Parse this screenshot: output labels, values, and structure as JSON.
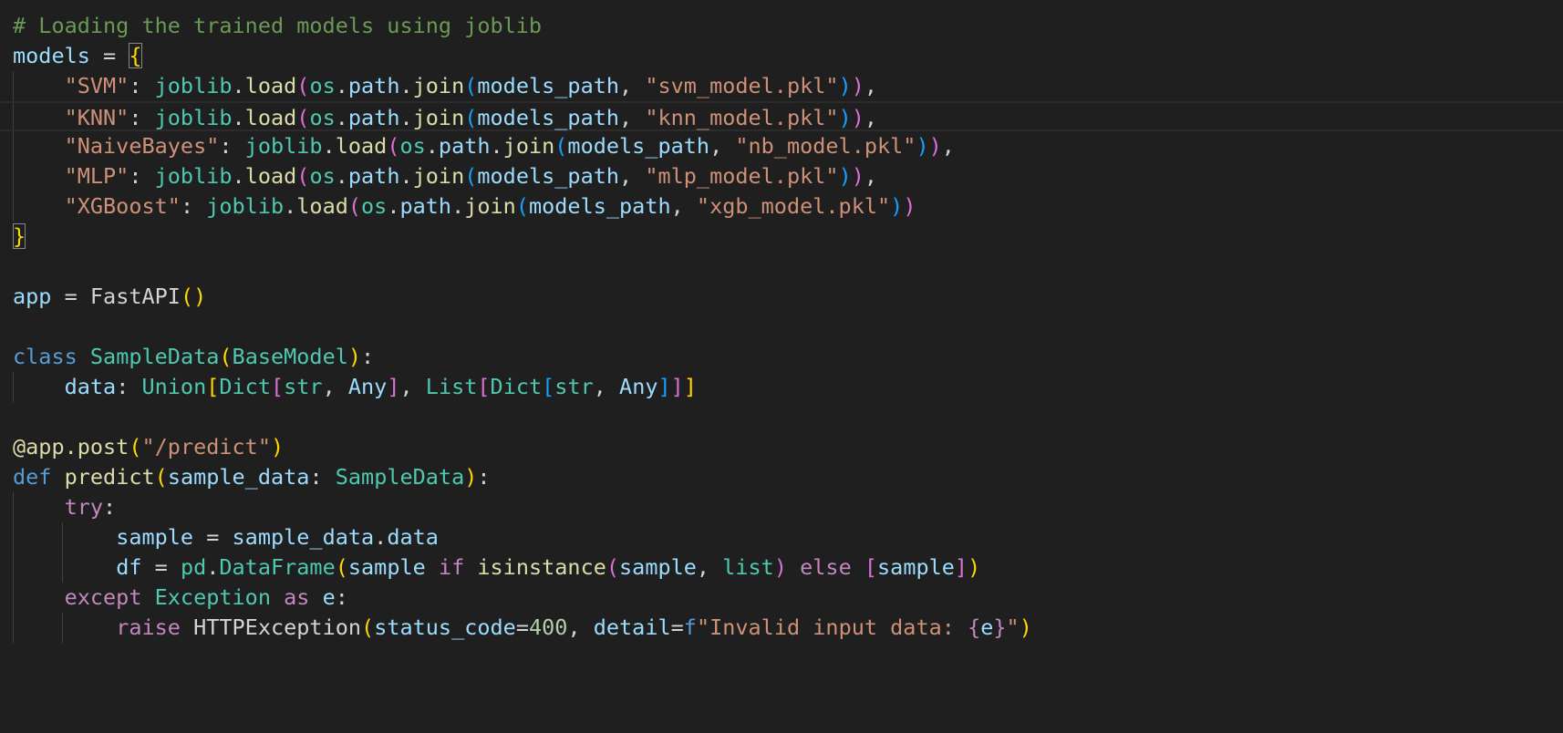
{
  "lines": [
    [
      {
        "t": "# Loading the trained models using joblib",
        "c": "comment"
      }
    ],
    [
      {
        "t": "models",
        "c": "var"
      },
      {
        "t": " = ",
        "c": "op"
      },
      {
        "t": "{",
        "c": "b1",
        "m": true
      }
    ],
    [
      {
        "t": "    ",
        "c": "op"
      },
      {
        "t": "\"SVM\"",
        "c": "str"
      },
      {
        "t": ": ",
        "c": "op"
      },
      {
        "t": "joblib",
        "c": "class"
      },
      {
        "t": ".",
        "c": "op"
      },
      {
        "t": "load",
        "c": "func"
      },
      {
        "t": "(",
        "c": "b2"
      },
      {
        "t": "os",
        "c": "class"
      },
      {
        "t": ".",
        "c": "op"
      },
      {
        "t": "path",
        "c": "var"
      },
      {
        "t": ".",
        "c": "op"
      },
      {
        "t": "join",
        "c": "func"
      },
      {
        "t": "(",
        "c": "b3"
      },
      {
        "t": "models_path",
        "c": "var"
      },
      {
        "t": ", ",
        "c": "op"
      },
      {
        "t": "\"svm_model.pkl\"",
        "c": "str"
      },
      {
        "t": ")",
        "c": "b3"
      },
      {
        "t": ")",
        "c": "b2"
      },
      {
        "t": ",",
        "c": "op"
      }
    ],
    [
      {
        "t": "    ",
        "c": "op"
      },
      {
        "t": "\"KNN\"",
        "c": "str"
      },
      {
        "t": ": ",
        "c": "op"
      },
      {
        "t": "joblib",
        "c": "class"
      },
      {
        "t": ".",
        "c": "op"
      },
      {
        "t": "load",
        "c": "func"
      },
      {
        "t": "(",
        "c": "b2"
      },
      {
        "t": "os",
        "c": "class"
      },
      {
        "t": ".",
        "c": "op"
      },
      {
        "t": "path",
        "c": "var"
      },
      {
        "t": ".",
        "c": "op"
      },
      {
        "t": "join",
        "c": "func"
      },
      {
        "t": "(",
        "c": "b3"
      },
      {
        "t": "models_path",
        "c": "var"
      },
      {
        "t": ", ",
        "c": "op"
      },
      {
        "t": "\"knn_model.pkl\"",
        "c": "str"
      },
      {
        "t": ")",
        "c": "b3"
      },
      {
        "t": ")",
        "c": "b2"
      },
      {
        "t": ",",
        "c": "op"
      }
    ],
    [
      {
        "t": "    ",
        "c": "op"
      },
      {
        "t": "\"NaiveBayes\"",
        "c": "str"
      },
      {
        "t": ": ",
        "c": "op"
      },
      {
        "t": "joblib",
        "c": "class"
      },
      {
        "t": ".",
        "c": "op"
      },
      {
        "t": "load",
        "c": "func"
      },
      {
        "t": "(",
        "c": "b2"
      },
      {
        "t": "os",
        "c": "class"
      },
      {
        "t": ".",
        "c": "op"
      },
      {
        "t": "path",
        "c": "var"
      },
      {
        "t": ".",
        "c": "op"
      },
      {
        "t": "join",
        "c": "func"
      },
      {
        "t": "(",
        "c": "b3"
      },
      {
        "t": "models_path",
        "c": "var"
      },
      {
        "t": ", ",
        "c": "op"
      },
      {
        "t": "\"nb_model.pkl\"",
        "c": "str"
      },
      {
        "t": ")",
        "c": "b3"
      },
      {
        "t": ")",
        "c": "b2"
      },
      {
        "t": ",",
        "c": "op"
      }
    ],
    [
      {
        "t": "    ",
        "c": "op"
      },
      {
        "t": "\"MLP\"",
        "c": "str"
      },
      {
        "t": ": ",
        "c": "op"
      },
      {
        "t": "joblib",
        "c": "class"
      },
      {
        "t": ".",
        "c": "op"
      },
      {
        "t": "load",
        "c": "func"
      },
      {
        "t": "(",
        "c": "b2"
      },
      {
        "t": "os",
        "c": "class"
      },
      {
        "t": ".",
        "c": "op"
      },
      {
        "t": "path",
        "c": "var"
      },
      {
        "t": ".",
        "c": "op"
      },
      {
        "t": "join",
        "c": "func"
      },
      {
        "t": "(",
        "c": "b3"
      },
      {
        "t": "models_path",
        "c": "var"
      },
      {
        "t": ", ",
        "c": "op"
      },
      {
        "t": "\"mlp_model.pkl\"",
        "c": "str"
      },
      {
        "t": ")",
        "c": "b3"
      },
      {
        "t": ")",
        "c": "b2"
      },
      {
        "t": ",",
        "c": "op"
      }
    ],
    [
      {
        "t": "    ",
        "c": "op"
      },
      {
        "t": "\"XGBoost\"",
        "c": "str"
      },
      {
        "t": ": ",
        "c": "op"
      },
      {
        "t": "joblib",
        "c": "class"
      },
      {
        "t": ".",
        "c": "op"
      },
      {
        "t": "load",
        "c": "func"
      },
      {
        "t": "(",
        "c": "b2"
      },
      {
        "t": "os",
        "c": "class"
      },
      {
        "t": ".",
        "c": "op"
      },
      {
        "t": "path",
        "c": "var"
      },
      {
        "t": ".",
        "c": "op"
      },
      {
        "t": "join",
        "c": "func"
      },
      {
        "t": "(",
        "c": "b3"
      },
      {
        "t": "models_path",
        "c": "var"
      },
      {
        "t": ", ",
        "c": "op"
      },
      {
        "t": "\"xgb_model.pkl\"",
        "c": "str"
      },
      {
        "t": ")",
        "c": "b3"
      },
      {
        "t": ")",
        "c": "b2"
      }
    ],
    [
      {
        "t": "}",
        "c": "b1",
        "m": true
      }
    ],
    [],
    [
      {
        "t": "app",
        "c": "var"
      },
      {
        "t": " = ",
        "c": "op"
      },
      {
        "t": "FastAPI",
        "c": "op"
      },
      {
        "t": "()",
        "c": "b1"
      }
    ],
    [],
    [
      {
        "t": "class",
        "c": "kw"
      },
      {
        "t": " ",
        "c": "op"
      },
      {
        "t": "SampleData",
        "c": "class"
      },
      {
        "t": "(",
        "c": "b1"
      },
      {
        "t": "BaseModel",
        "c": "class"
      },
      {
        "t": ")",
        "c": "b1"
      },
      {
        "t": ":",
        "c": "op"
      }
    ],
    [
      {
        "t": "    ",
        "c": "op"
      },
      {
        "t": "data",
        "c": "var"
      },
      {
        "t": ": ",
        "c": "op"
      },
      {
        "t": "Union",
        "c": "class"
      },
      {
        "t": "[",
        "c": "b1"
      },
      {
        "t": "Dict",
        "c": "class"
      },
      {
        "t": "[",
        "c": "b2"
      },
      {
        "t": "str",
        "c": "class"
      },
      {
        "t": ", ",
        "c": "op"
      },
      {
        "t": "Any",
        "c": "var"
      },
      {
        "t": "]",
        "c": "b2"
      },
      {
        "t": ", ",
        "c": "op"
      },
      {
        "t": "List",
        "c": "class"
      },
      {
        "t": "[",
        "c": "b2"
      },
      {
        "t": "Dict",
        "c": "class"
      },
      {
        "t": "[",
        "c": "b3"
      },
      {
        "t": "str",
        "c": "class"
      },
      {
        "t": ", ",
        "c": "op"
      },
      {
        "t": "Any",
        "c": "var"
      },
      {
        "t": "]",
        "c": "b3"
      },
      {
        "t": "]",
        "c": "b2"
      },
      {
        "t": "]",
        "c": "b1"
      }
    ],
    [],
    [
      {
        "t": "@app.post",
        "c": "func"
      },
      {
        "t": "(",
        "c": "b1"
      },
      {
        "t": "\"/predict\"",
        "c": "str"
      },
      {
        "t": ")",
        "c": "b1"
      }
    ],
    [
      {
        "t": "def",
        "c": "kw"
      },
      {
        "t": " ",
        "c": "op"
      },
      {
        "t": "predict",
        "c": "func"
      },
      {
        "t": "(",
        "c": "b1"
      },
      {
        "t": "sample_data",
        "c": "var"
      },
      {
        "t": ": ",
        "c": "op"
      },
      {
        "t": "SampleData",
        "c": "class"
      },
      {
        "t": ")",
        "c": "b1"
      },
      {
        "t": ":",
        "c": "op"
      }
    ],
    [
      {
        "t": "    ",
        "c": "op"
      },
      {
        "t": "try",
        "c": "ctrl"
      },
      {
        "t": ":",
        "c": "op"
      }
    ],
    [
      {
        "t": "        ",
        "c": "op"
      },
      {
        "t": "sample",
        "c": "var"
      },
      {
        "t": " = ",
        "c": "op"
      },
      {
        "t": "sample_data",
        "c": "var"
      },
      {
        "t": ".",
        "c": "op"
      },
      {
        "t": "data",
        "c": "var"
      }
    ],
    [
      {
        "t": "        ",
        "c": "op"
      },
      {
        "t": "df",
        "c": "var"
      },
      {
        "t": " = ",
        "c": "op"
      },
      {
        "t": "pd",
        "c": "class"
      },
      {
        "t": ".",
        "c": "op"
      },
      {
        "t": "DataFrame",
        "c": "class"
      },
      {
        "t": "(",
        "c": "b1"
      },
      {
        "t": "sample",
        "c": "var"
      },
      {
        "t": " ",
        "c": "op"
      },
      {
        "t": "if",
        "c": "ctrl"
      },
      {
        "t": " ",
        "c": "op"
      },
      {
        "t": "isinstance",
        "c": "func"
      },
      {
        "t": "(",
        "c": "b2"
      },
      {
        "t": "sample",
        "c": "var"
      },
      {
        "t": ", ",
        "c": "op"
      },
      {
        "t": "list",
        "c": "class"
      },
      {
        "t": ")",
        "c": "b2"
      },
      {
        "t": " ",
        "c": "op"
      },
      {
        "t": "else",
        "c": "ctrl"
      },
      {
        "t": " ",
        "c": "op"
      },
      {
        "t": "[",
        "c": "b2"
      },
      {
        "t": "sample",
        "c": "var"
      },
      {
        "t": "]",
        "c": "b2"
      },
      {
        "t": ")",
        "c": "b1"
      }
    ],
    [
      {
        "t": "    ",
        "c": "op"
      },
      {
        "t": "except",
        "c": "ctrl"
      },
      {
        "t": " ",
        "c": "op"
      },
      {
        "t": "Exception",
        "c": "class"
      },
      {
        "t": " ",
        "c": "op"
      },
      {
        "t": "as",
        "c": "ctrl"
      },
      {
        "t": " ",
        "c": "op"
      },
      {
        "t": "e",
        "c": "var"
      },
      {
        "t": ":",
        "c": "op"
      }
    ],
    [
      {
        "t": "        ",
        "c": "op"
      },
      {
        "t": "raise",
        "c": "ctrl"
      },
      {
        "t": " ",
        "c": "op"
      },
      {
        "t": "HTTPException",
        "c": "op"
      },
      {
        "t": "(",
        "c": "b1"
      },
      {
        "t": "status_code",
        "c": "var"
      },
      {
        "t": "=",
        "c": "op"
      },
      {
        "t": "400",
        "c": "num"
      },
      {
        "t": ", ",
        "c": "op"
      },
      {
        "t": "detail",
        "c": "var"
      },
      {
        "t": "=",
        "c": "op"
      },
      {
        "t": "f",
        "c": "kw"
      },
      {
        "t": "\"Invalid input data: ",
        "c": "str"
      },
      {
        "t": "{",
        "c": "ctrl"
      },
      {
        "t": "e",
        "c": "var"
      },
      {
        "t": "}",
        "c": "ctrl"
      },
      {
        "t": "\"",
        "c": "str"
      },
      {
        "t": ")",
        "c": "b1"
      }
    ],
    []
  ],
  "current_line": 4,
  "colors": {
    "background": "#1f1f1f",
    "comment": "#6a9955",
    "string": "#ce9178",
    "keyword": "#569cd6",
    "control": "#c586c0",
    "type": "#4ec9b0",
    "function": "#dcdcaa",
    "variable": "#9cdcfe",
    "number": "#b5cea8"
  }
}
